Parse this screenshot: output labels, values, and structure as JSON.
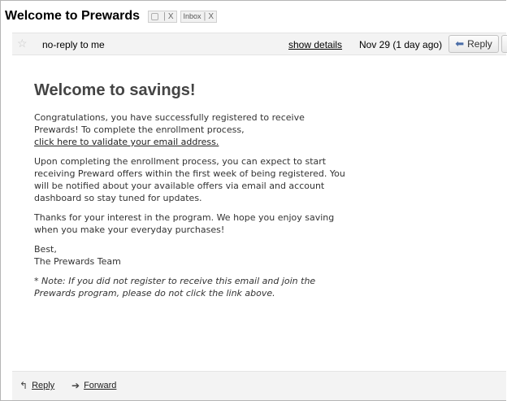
{
  "thread": {
    "subject": "Welcome to Prewards",
    "labels": [
      {
        "icon": "label-chip-icon",
        "close": "X"
      },
      {
        "text": "Inbox",
        "close": "X"
      }
    ]
  },
  "message_header": {
    "sender": "no-reply to me",
    "show_details": "show details",
    "date": "Nov 29 (1 day ago)",
    "reply_label": "Reply"
  },
  "message_body": {
    "heading": "Welcome to savings!",
    "para1_text": "Congratulations, you have successfully registered to receive Prewards! To complete the enrollment process,",
    "para1_link": "click here to validate your email address.",
    "para2": "Upon completing the enrollment process, you can expect to start receiving Preward offers within the first week of being registered. You will be notified about your available offers via email and account dashboard so stay tuned for updates.",
    "para3": "Thanks for your interest in the program. We hope you enjoy saving when you make your everyday purchases!",
    "signoff": "Best,",
    "signature": "The Prewards Team",
    "note": "* Note: If you did not register to receive this email and join the Prewards program, please do not click the link above."
  },
  "footer": {
    "reply_label": "Reply",
    "forward_label": "Forward"
  },
  "colors": {
    "header_bg": "#f3f3f3",
    "link": "#222222",
    "heading": "#444444"
  }
}
